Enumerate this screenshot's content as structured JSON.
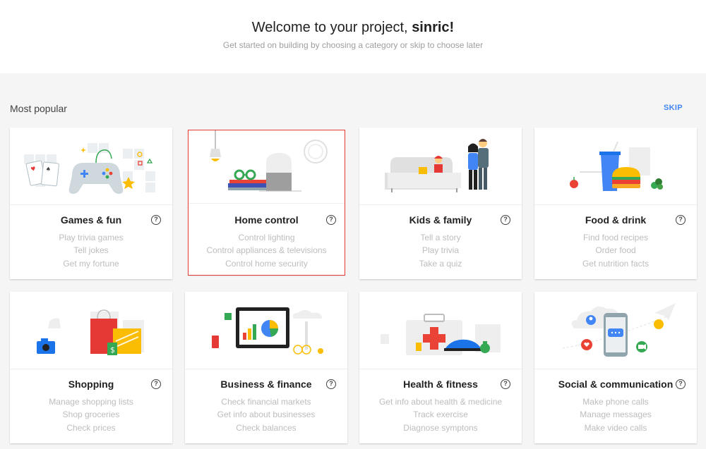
{
  "header": {
    "welcome_prefix": "Welcome to your project,",
    "project_name": "sinric!",
    "subtitle": "Get started on building by choosing a category or skip to choose later"
  },
  "section": {
    "label": "Most popular",
    "skip_label": "SKIP"
  },
  "help_glyph": "?",
  "cards": [
    {
      "title": "Games & fun",
      "examples": [
        "Play trivia games",
        "Tell jokes",
        "Get my fortune"
      ],
      "illustration": "gamepad-illustration"
    },
    {
      "title": "Home control",
      "examples": [
        "Control lighting",
        "Control appliances & televisions",
        "Control home security"
      ],
      "illustration": "smart-speaker-illustration",
      "selected": true
    },
    {
      "title": "Kids & family",
      "examples": [
        "Tell a story",
        "Play trivia",
        "Take a quiz"
      ],
      "illustration": "family-illustration"
    },
    {
      "title": "Food & drink",
      "examples": [
        "Find food recipes",
        "Order food",
        "Get nutrition facts"
      ],
      "illustration": "burger-drink-illustration"
    },
    {
      "title": "Shopping",
      "examples": [
        "Manage shopping lists",
        "Shop groceries",
        "Check prices"
      ],
      "illustration": "shopping-bags-illustration"
    },
    {
      "title": "Business & finance",
      "examples": [
        "Check financial markets",
        "Get info about businesses",
        "Check balances"
      ],
      "illustration": "business-chart-illustration"
    },
    {
      "title": "Health & fitness",
      "examples": [
        "Get info about health & medicine",
        "Track exercise",
        "Diagnose symptons"
      ],
      "illustration": "first-aid-illustration"
    },
    {
      "title": "Social & communication",
      "examples": [
        "Make phone calls",
        "Manage messages",
        "Make video calls"
      ],
      "illustration": "phone-chat-illustration"
    }
  ],
  "colors": {
    "accent_blue": "#4285f4",
    "accent_red": "#ea4335",
    "accent_yellow": "#fbbc04",
    "accent_green": "#34a853",
    "selection_border": "#e53935"
  }
}
